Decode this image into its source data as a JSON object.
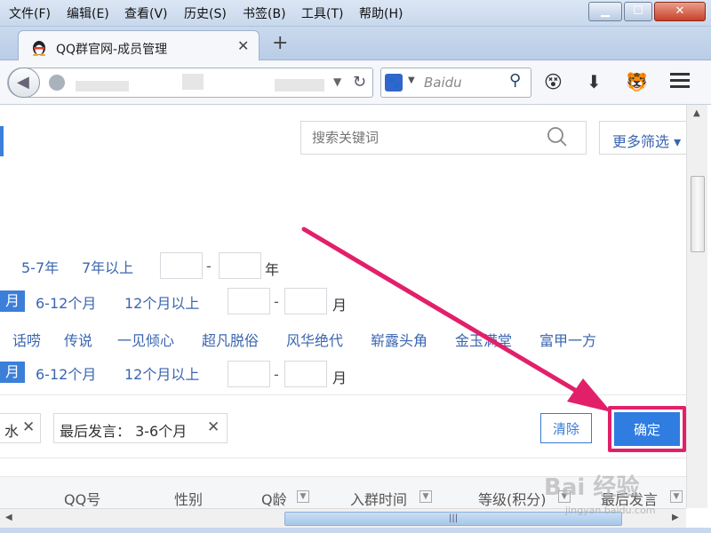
{
  "menubar": {
    "items": [
      "文件(F)",
      "编辑(E)",
      "查看(V)",
      "历史(S)",
      "书签(B)",
      "工具(T)",
      "帮助(H)"
    ]
  },
  "tab": {
    "title": "QQ群官网-成员管理",
    "close": "✕",
    "new_tab": "+"
  },
  "navbar": {
    "search_engine": "Baidu"
  },
  "page": {
    "search": {
      "placeholder": "搜索关键词"
    },
    "more_filter": "更多筛选 ▾",
    "rows": {
      "row1": {
        "opts": [
          "5-7年",
          "7年以上"
        ],
        "unit": "年"
      },
      "row2": {
        "selected": "月",
        "opts": [
          "6-12个月",
          "12个月以上"
        ],
        "unit": "月"
      },
      "row3": {
        "opts": [
          "话唠",
          "传说",
          "一见倾心",
          "超凡脱俗",
          "风华绝代",
          "崭露头角",
          "金玉满堂",
          "富甲一方"
        ]
      },
      "row4": {
        "selected": "月",
        "opts": [
          "6-12个月",
          "12个月以上"
        ],
        "unit": "月"
      }
    },
    "dash": "-",
    "chips": [
      {
        "label": "水",
        "x": "✕"
      },
      {
        "label": "最后发言： 3-6个月",
        "x": "✕"
      }
    ],
    "clear_button": "清除",
    "confirm_button": "确定",
    "table_headers": [
      "QQ号",
      "性别",
      "Q龄",
      "入群时间",
      "等级(积分)",
      "最后发言"
    ]
  },
  "watermark": {
    "main": "Bai 经验",
    "sub": "jingyan.baidu.com"
  },
  "colors": {
    "accent": "#2f7de1",
    "link": "#3a66b0",
    "highlight": "#e2206a"
  }
}
